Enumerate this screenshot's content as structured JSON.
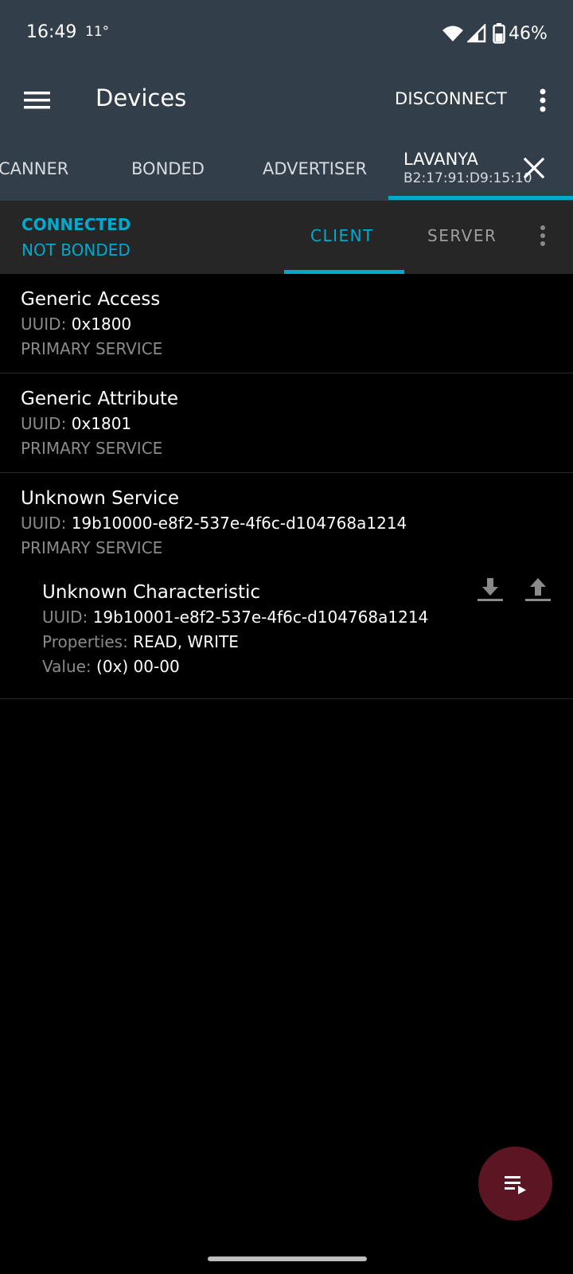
{
  "status_bar": {
    "time": "16:49",
    "temperature": "11°",
    "battery": "46%",
    "icons": [
      "wifi-icon",
      "signal-icon",
      "battery-icon"
    ]
  },
  "toolbar": {
    "title": "Devices",
    "disconnect_label": "DISCONNECT",
    "menu_icon": "menu-icon",
    "overflow_icon": "overflow-menu-icon"
  },
  "tabs": {
    "scanner": "CANNER",
    "bonded": "BONDED",
    "advertiser": "ADVERTISER",
    "device": {
      "name": "LAVANYA",
      "mac": "B2:17:91:D9:15:10"
    }
  },
  "connection": {
    "status": "CONNECTED",
    "bond": "NOT BONDED",
    "client_tab": "CLIENT",
    "server_tab": "SERVER"
  },
  "labels": {
    "uuid": "UUID:",
    "properties": "Properties:",
    "value": "Value:"
  },
  "services": [
    {
      "name": "Generic Access",
      "uuid": "0x1800",
      "type": "PRIMARY SERVICE"
    },
    {
      "name": "Generic Attribute",
      "uuid": "0x1801",
      "type": "PRIMARY SERVICE"
    },
    {
      "name": "Unknown Service",
      "uuid": "19b10000-e8f2-537e-4f6c-d104768a1214",
      "type": "PRIMARY SERVICE",
      "characteristic": {
        "name": "Unknown Characteristic",
        "uuid": "19b10001-e8f2-537e-4f6c-d104768a1214",
        "properties": "READ, WRITE",
        "value": "(0x) 00-00"
      }
    }
  ],
  "colors": {
    "app_bar": "#323e4a",
    "accent": "#00a9ce",
    "connection_bar": "#262626",
    "fab": "#5c1523"
  }
}
